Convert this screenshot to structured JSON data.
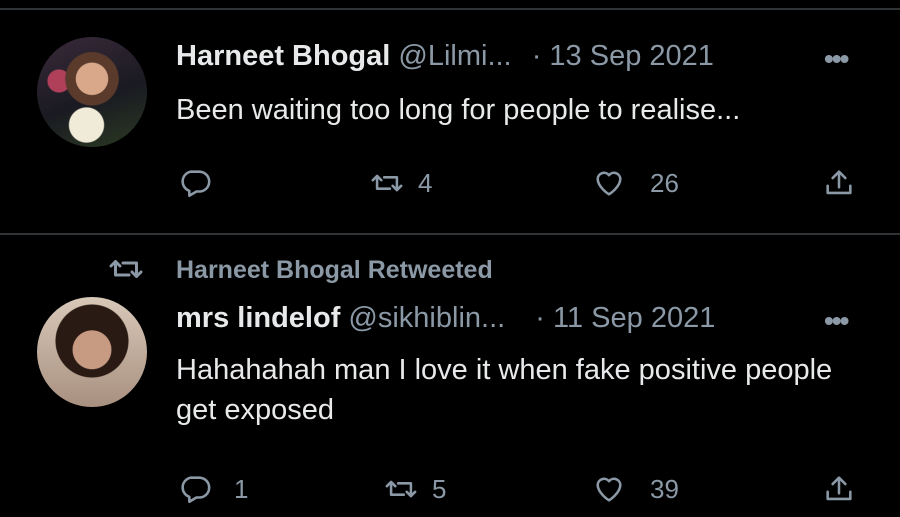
{
  "tweets": [
    {
      "display_name": "Harneet Bhogal",
      "handle": "@Lilmi...",
      "separator": "·",
      "date": "13 Sep 2021",
      "text": "Been waiting too long for people to realise...",
      "replies": "",
      "retweets": "4",
      "likes": "26",
      "more": "•••"
    },
    {
      "retweet_label": "Harneet Bhogal Retweeted",
      "display_name": "mrs lindelof",
      "handle": "@sikhiblin...",
      "separator": "·",
      "date": "11 Sep 2021",
      "text": "Hahahahah man I love it when fake positive people get exposed",
      "replies": "1",
      "retweets": "5",
      "likes": "39",
      "more": "•••"
    }
  ],
  "colors": {
    "background": "#000000",
    "text": "#e7e9ea",
    "muted": "#8b98a5",
    "divider": "#2f3336"
  },
  "icons": [
    "reply-icon",
    "retweet-icon",
    "like-icon",
    "share-icon",
    "more-icon"
  ]
}
